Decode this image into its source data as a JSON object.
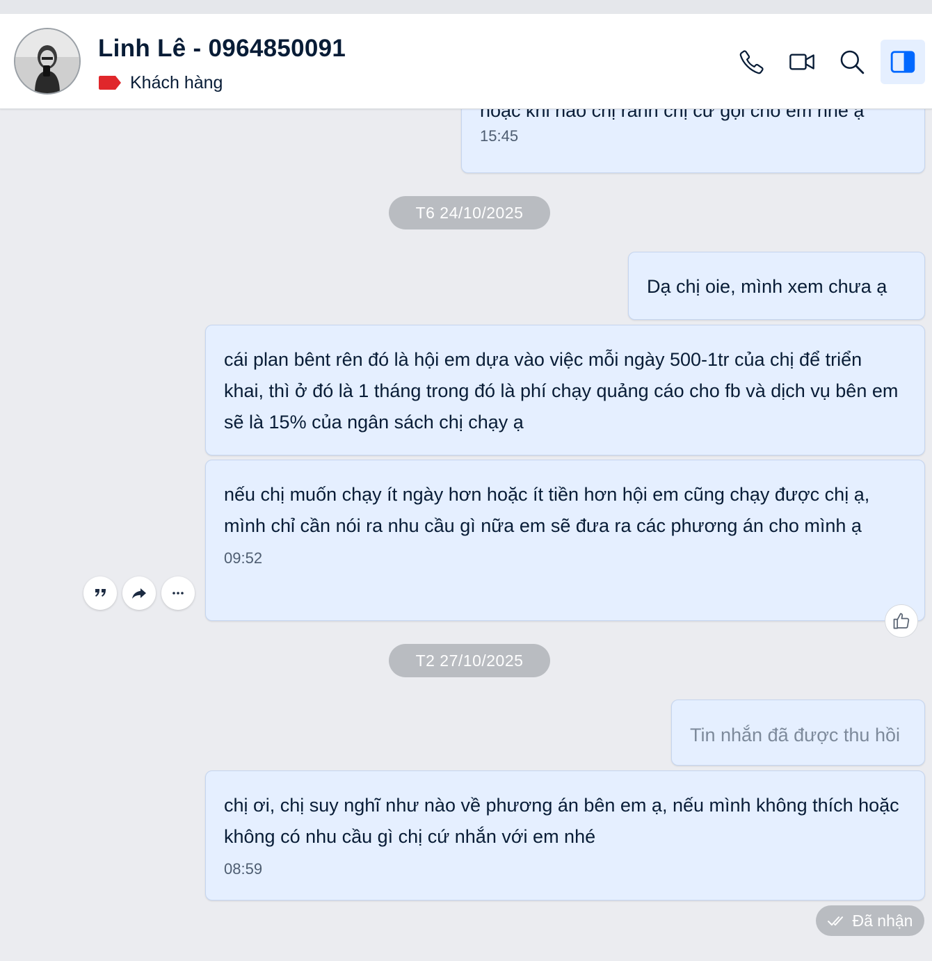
{
  "header": {
    "contact_name": "Linh Lê - 0964850091",
    "tag_label": "Khách hàng",
    "tag_color": "#e0272b",
    "buttons": [
      "phone-icon",
      "video-icon",
      "search-icon",
      "sidebar-toggle-icon"
    ],
    "accent_color": "#0068ff"
  },
  "messages": {
    "m1": {
      "text": "hoặc khi nào chị rảnh chị cứ gọi cho em nhé ạ",
      "time": "15:45"
    },
    "date1": "T6 24/10/2025",
    "m2": {
      "text": "Dạ chị oie, mình xem chưa ạ"
    },
    "m3": {
      "text": "cái plan bênt rên đó là hội em dựa vào việc mỗi ngày 500-1tr của chị để triển khai, thì ở đó là 1 tháng trong đó là phí chạy quảng cáo cho fb và dịch vụ bên em sẽ là 15% của ngân sách chị chạy ạ"
    },
    "m4": {
      "text": "nếu chị muốn chạy ít ngày hơn hoặc ít tiền hơn hội em cũng chạy được chị ạ, mình chỉ cần nói ra nhu cầu gì nữa em sẽ đưa ra các phương án cho mình ạ",
      "time": "09:52"
    },
    "date2": "T2 27/10/2025",
    "m5": {
      "text": "Tin nhắn đã được thu hồi"
    },
    "m6": {
      "text": "chị ơi, chị suy nghĩ như nào về phương án bên em ạ, nếu mình không thích hoặc không có nhu cầu gì chị cứ nhắn với em nhé",
      "time": "08:59"
    }
  },
  "message_actions": [
    "quote-icon",
    "forward-icon",
    "more-icon"
  ],
  "reaction_icon": "thumbs-up-icon",
  "delivery_status": "Đã nhận"
}
